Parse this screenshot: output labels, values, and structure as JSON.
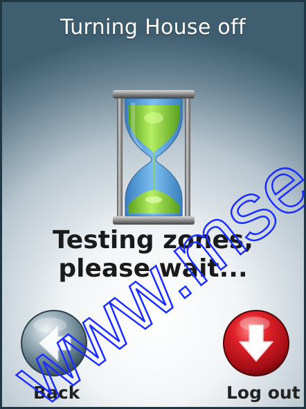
{
  "header": {
    "title": "Turning House off"
  },
  "status": {
    "line1": "Testing zones,",
    "line2": "please wait..."
  },
  "nav": {
    "back_label": "Back",
    "logout_label": "Log out"
  },
  "icons": {
    "progress": "hourglass-icon",
    "back": "back-arrow-icon",
    "logout": "logout-arrow-icon"
  },
  "colors": {
    "back_button": "#7a93a0",
    "logout_button": "#c8141c",
    "sand": "#8fd23a",
    "glass": "#4f9bd8",
    "watermark": "#1a2cff"
  },
  "watermark": {
    "text": "www.mse"
  }
}
